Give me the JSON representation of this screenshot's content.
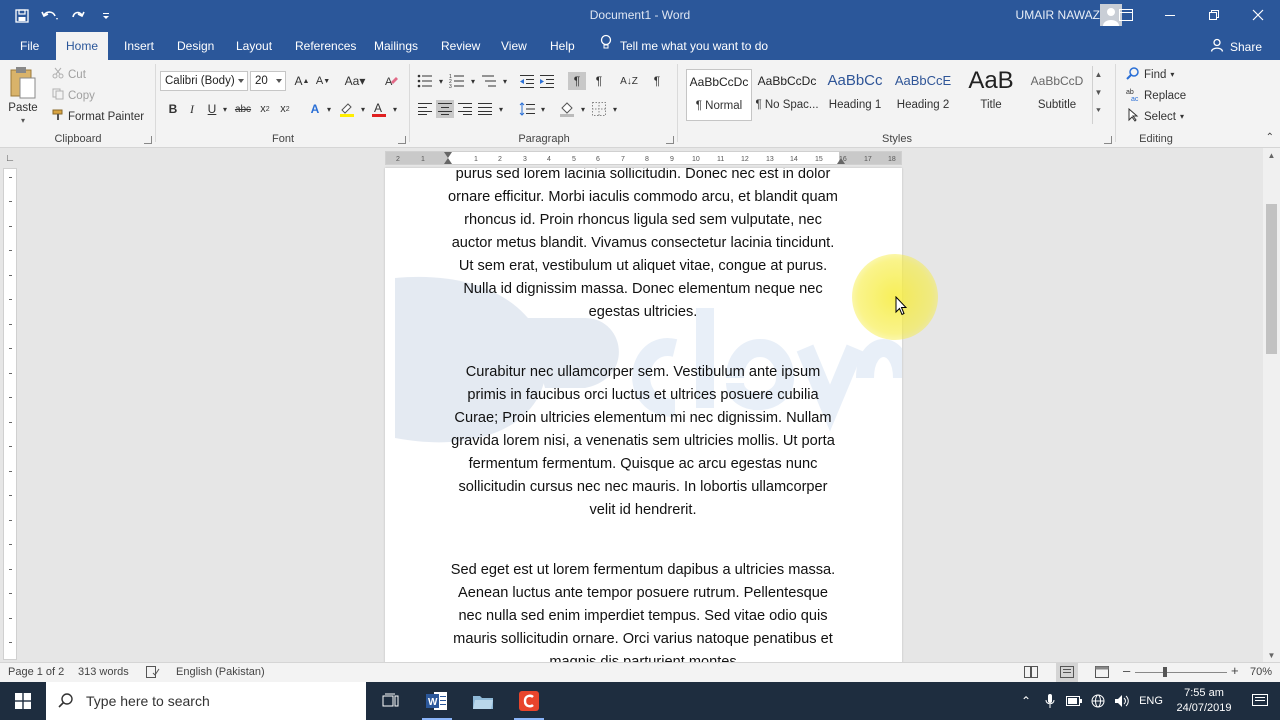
{
  "window": {
    "title": "Document1 - Word",
    "user": "UMAIR NAWAZ"
  },
  "tabs": [
    {
      "label": "File"
    },
    {
      "label": "Home"
    },
    {
      "label": "Insert"
    },
    {
      "label": "Design"
    },
    {
      "label": "Layout"
    },
    {
      "label": "References"
    },
    {
      "label": "Mailings"
    },
    {
      "label": "Review"
    },
    {
      "label": "View"
    },
    {
      "label": "Help"
    }
  ],
  "tell_me": "Tell me what you want to do",
  "share": "Share",
  "clipboard": {
    "label": "Clipboard",
    "paste": "Paste",
    "cut": "Cut",
    "copy": "Copy",
    "format_painter": "Format Painter"
  },
  "font": {
    "label": "Font",
    "family": "Calibri (Body)",
    "size": "20"
  },
  "paragraph": {
    "label": "Paragraph"
  },
  "styles": {
    "label": "Styles",
    "items": [
      {
        "sample": "AaBbCcDc",
        "name": "¶ Normal"
      },
      {
        "sample": "AaBbCcDc",
        "name": "¶ No Spac..."
      },
      {
        "sample": "AaBbCc",
        "name": "Heading 1"
      },
      {
        "sample": "AaBbCcE",
        "name": "Heading 2"
      },
      {
        "sample": "AaB",
        "name": "Title"
      },
      {
        "sample": "AaBbCcD",
        "name": "Subtitle"
      }
    ]
  },
  "editing": {
    "label": "Editing",
    "find": "Find",
    "replace": "Replace",
    "select": "Select"
  },
  "document": {
    "paragraphs": [
      "purus sed lorem lacinia sollicitudin. Donec nec est in dolor ornare efficitur. Morbi iaculis commodo arcu, et blandit quam rhoncus id. Proin rhoncus ligula sed sem vulputate, nec auctor metus blandit. Vivamus consectetur lacinia tincidunt. Ut sem erat, vestibulum ut aliquet vitae, congue at purus. Nulla id dignissim massa. Donec elementum neque nec egestas ultricies.",
      "Curabitur nec ullamcorper sem. Vestibulum ante ipsum primis in faucibus orci luctus et ultrices posuere cubilia Curae; Proin ultricies elementum mi nec dignissim. Nullam gravida lorem nisi, a venenatis sem ultricies mollis. Ut porta fermentum fermentum. Quisque ac arcu egestas nunc sollicitudin cursus nec nec mauris. In lobortis ullamcorper velit id hendrerit.",
      "Sed eget est ut lorem fermentum dapibus a ultricies massa. Aenean luctus ante tempor posuere rutrum. Pellentesque nec nulla sed enim imperdiet tempus. Sed vitae odio quis mauris sollicitudin ornare. Orci varius natoque penatibus et magnis dis parturient montes"
    ]
  },
  "status": {
    "page": "Page 1 of 2",
    "words": "313 words",
    "language": "English (Pakistan)",
    "zoom": "70%"
  },
  "taskbar": {
    "search_placeholder": "Type here to search",
    "tray_lang": "ENG",
    "time": "7:55 am",
    "date": "24/07/2019"
  },
  "colors": {
    "word_blue": "#2b579a",
    "taskbar": "#1e2d3f",
    "cursor_highlight": "#f6ec3c"
  }
}
